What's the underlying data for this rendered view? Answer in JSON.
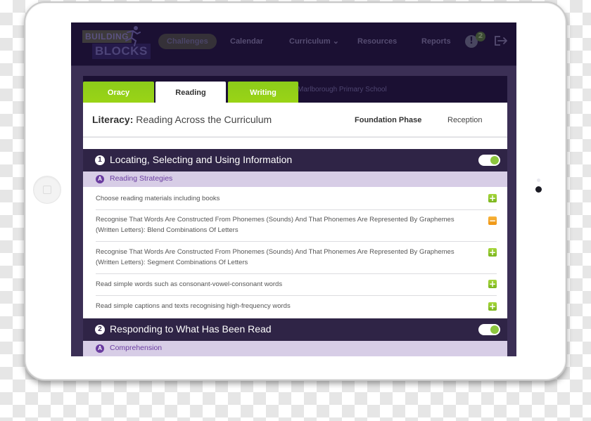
{
  "app": {
    "logo": {
      "line1": "BUILDING",
      "line2": "BLOCKS"
    },
    "nav": [
      {
        "label": "Challenges",
        "active": true
      },
      {
        "label": "Calendar",
        "active": false
      },
      {
        "label": "Curriculum ⌄",
        "active": false
      },
      {
        "label": "Resources",
        "active": false
      },
      {
        "label": "Reports",
        "active": false
      }
    ],
    "alert": {
      "icon": "!",
      "count": "2"
    },
    "logout_icon": "logout-icon"
  },
  "tabs": [
    {
      "label": "Oracy",
      "active": false
    },
    {
      "label": "Reading",
      "active": true
    },
    {
      "label": "Writing",
      "active": false
    }
  ],
  "school": "Marlborough Primary School",
  "header": {
    "title_bold": "Literacy:",
    "title_rest": " Reading Across the Curriculum",
    "phase": "Foundation Phase",
    "year": "Reception"
  },
  "sections": [
    {
      "number": "1",
      "title": "Locating, Selecting and Using Information",
      "toggle_on": true,
      "subsection": {
        "letter": "A",
        "title": "Reading Strategies"
      },
      "items": [
        {
          "text": "Choose reading materials including books",
          "action": "add"
        },
        {
          "text": "Recognise That Words Are Constructed From Phonemes (Sounds) And That Phonemes Are Represented By Graphemes (Written Letters): Blend Combinations Of Letters",
          "action": "remove"
        },
        {
          "text": "Recognise That Words Are Constructed From Phonemes (Sounds) And That Phonemes Are Represented By Graphemes (Written Letters): Segment Combinations Of Letters",
          "action": "add"
        },
        {
          "text": "Read simple words such as consonant-vowel-consonant words",
          "action": "add"
        },
        {
          "text": "Read simple captions and texts recognising high-frequency words",
          "action": "add"
        }
      ]
    },
    {
      "number": "2",
      "title": "Responding to What Has Been Read",
      "toggle_on": true,
      "subsection": {
        "letter": "A",
        "title": "Comprehension"
      }
    }
  ],
  "action_symbols": {
    "add": "+",
    "remove": "−"
  },
  "colors": {
    "nav_bg": "#1b1033",
    "section_bg": "#2f2446",
    "subsection_bg": "#d7cde6",
    "tab_green": "#8ccc1a",
    "accent_purple": "#6a3ca0",
    "add_green": "#8cc63e",
    "remove_orange": "#f39c1a"
  }
}
